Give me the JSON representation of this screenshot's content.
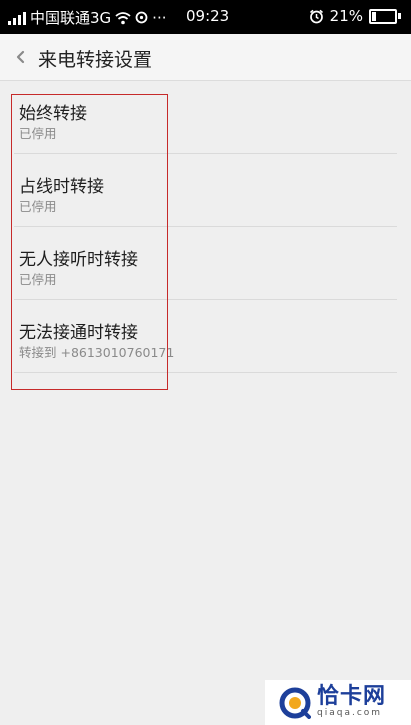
{
  "status_bar": {
    "carrier": "中国联通3G",
    "more": "···",
    "time": "09:23",
    "battery_percent": "21%",
    "battery_level": 0.21,
    "icons": [
      "signal-icon",
      "wifi-icon",
      "sync-icon",
      "alarm-icon",
      "battery-icon"
    ]
  },
  "header": {
    "title": "来电转接设置",
    "back_icon": "chevron-left-icon"
  },
  "items": [
    {
      "title": "始终转接",
      "subtitle": "已停用"
    },
    {
      "title": "占线时转接",
      "subtitle": "已停用"
    },
    {
      "title": "无人接听时转接",
      "subtitle": "已停用"
    },
    {
      "title": "无法接通时转接",
      "subtitle": "转接到 +8613010760171"
    }
  ],
  "watermark": {
    "main": "恰卡网",
    "sub": "qiaqa.com"
  },
  "colors": {
    "status_bar": "#000000",
    "header_bg": "#f5f5f5",
    "page_bg": "#efefef",
    "highlight_border": "#c62a2a",
    "watermark_blue": "#1d3f9a"
  }
}
